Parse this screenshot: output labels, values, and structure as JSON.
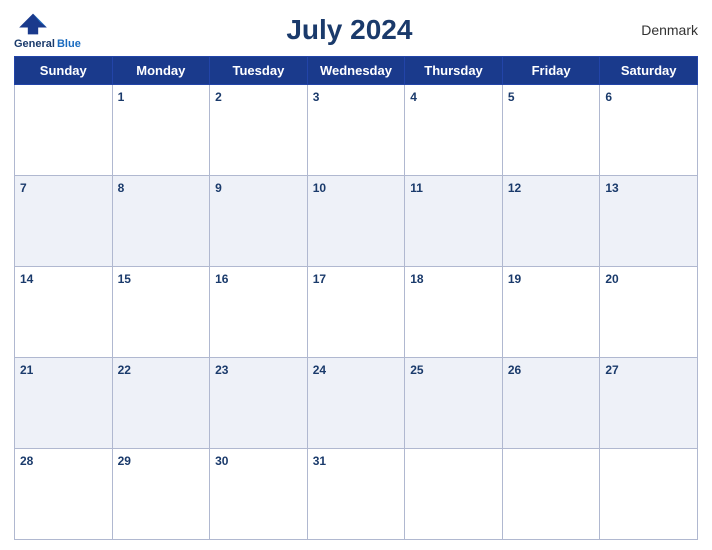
{
  "header": {
    "logo_line1": "General",
    "logo_line2": "Blue",
    "title": "July 2024",
    "country": "Denmark"
  },
  "weekdays": [
    "Sunday",
    "Monday",
    "Tuesday",
    "Wednesday",
    "Thursday",
    "Friday",
    "Saturday"
  ],
  "weeks": [
    [
      null,
      1,
      2,
      3,
      4,
      5,
      6
    ],
    [
      7,
      8,
      9,
      10,
      11,
      12,
      13
    ],
    [
      14,
      15,
      16,
      17,
      18,
      19,
      20
    ],
    [
      21,
      22,
      23,
      24,
      25,
      26,
      27
    ],
    [
      28,
      29,
      30,
      31,
      null,
      null,
      null
    ]
  ]
}
